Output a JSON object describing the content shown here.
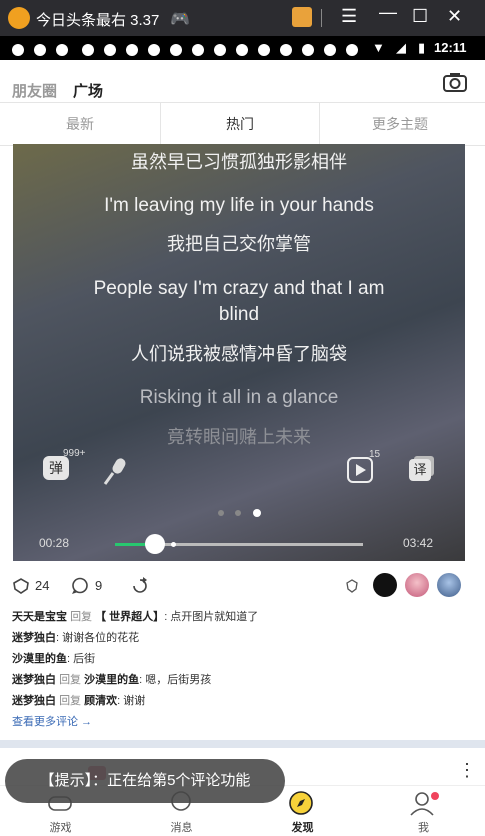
{
  "window": {
    "title": "今日头条最右 3.37"
  },
  "statusbar": {
    "time": "12:11"
  },
  "header": {
    "friends_tab": "朋友圈",
    "square_tab": "广场"
  },
  "tabs": {
    "latest": "最新",
    "hot": "热门",
    "more": "更多主题"
  },
  "video": {
    "lyrics": [
      "虽然早已习惯孤独形影相伴",
      "I'm leaving my life in your hands",
      "我把自己交你掌管",
      "People say I'm crazy and that I am",
      "blind",
      "人们说我被感情冲昏了脑袋",
      "Risking it all in a glance",
      "竟转眼间赌上未来"
    ],
    "danmu_label": "弹",
    "danmu_count": "999+",
    "share_count": "15",
    "translate_label": "译",
    "time_current": "00:28",
    "time_total": "03:42",
    "progress": 0.16
  },
  "actions": {
    "likes": "24",
    "comments": "9"
  },
  "comments": [
    {
      "user": "天天是宝宝",
      "verb": "回复",
      "target": "【 世界超人】",
      "text": ": 点开图片就知道了"
    },
    {
      "user": "迷梦独白",
      "verb": "",
      "target": "",
      "text": ": 谢谢各位的花花"
    },
    {
      "user": "沙漠里的鱼",
      "verb": "",
      "target": "",
      "text": ": 后街"
    },
    {
      "user": "迷梦独白",
      "verb": "回复",
      "target": "沙漠里的鱼",
      "text": ": 嗯，后街男孩"
    },
    {
      "user": "迷梦独白",
      "verb": "回复",
      "target": "顾清欢",
      "text": ": 谢谢"
    }
  ],
  "more_comments": "查看更多评论 →",
  "toast": "【提示】：正在给第5个评论功能",
  "nav": {
    "games": "游戏",
    "messages": "消息",
    "discover": "发现",
    "me": "我"
  }
}
